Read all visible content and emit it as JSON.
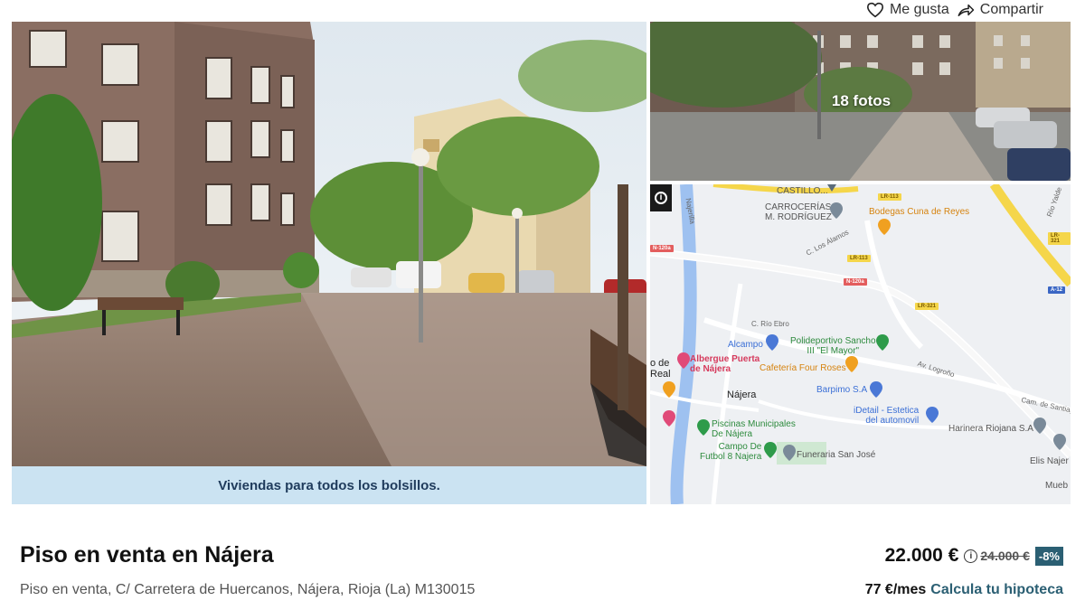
{
  "actions": {
    "like_label": "Me gusta",
    "share_label": "Compartir"
  },
  "gallery": {
    "banner_text": "Viviendas para todos los bolsillos.",
    "photos_count_label": "18 fotos"
  },
  "map": {
    "labels": {
      "castillo": "CASTILLO...",
      "carrocerias": "CARROCERÍAS\nM. RODRÍGUEZ",
      "bodegas": "Bodegas Cuna de Reyes",
      "polideportivo": "Polideportivo Sancho\nIII \"El Mayor\"",
      "alcampo": "Alcampo",
      "albergue": "Albergue Puerta\nde Nájera",
      "cafeteria": "Cafetería Four Roses",
      "de_real": "o de\nReal",
      "najera": "Nájera",
      "barpimo": "Barpimo S.A",
      "idetail": "iDetail - Estetica\ndel automovil",
      "harinera": "Harinera Riojana S.A",
      "piscinas": "Piscinas Municipales\nDe Nájera",
      "campo": "Campo De\nFutbol 8 Najera",
      "funeraria": "Funeraria San José",
      "elis": "Elis Najer",
      "mueb": "Mueb",
      "c_rio_ebro": "C. Río Ebro",
      "av_logrono": "Av. Logroño",
      "c_los_alamos": "C. Los Álamos",
      "cam_santiago": "Cam. de Santiag",
      "rio_yalde": "Río Yalde",
      "najerilla": "Najerilla"
    },
    "road_badges": {
      "lr113_a": "LR-113",
      "lr113_b": "LR-113",
      "lr321_a": "LR-321",
      "lr321_b": "LR-321",
      "n120a_a": "N-120a",
      "n120a_b": "N-120a",
      "a12": "A-12"
    }
  },
  "listing": {
    "title": "Piso en venta en Nájera",
    "subtitle": "Piso en venta, C/ Carretera de Huercanos, Nájera, Rioja (La) M130015",
    "price": "22.000 €",
    "old_price": "24.000 €",
    "discount": "-8%",
    "monthly": "77 €/mes",
    "mortgage_link": "Calcula tu hipoteca"
  }
}
